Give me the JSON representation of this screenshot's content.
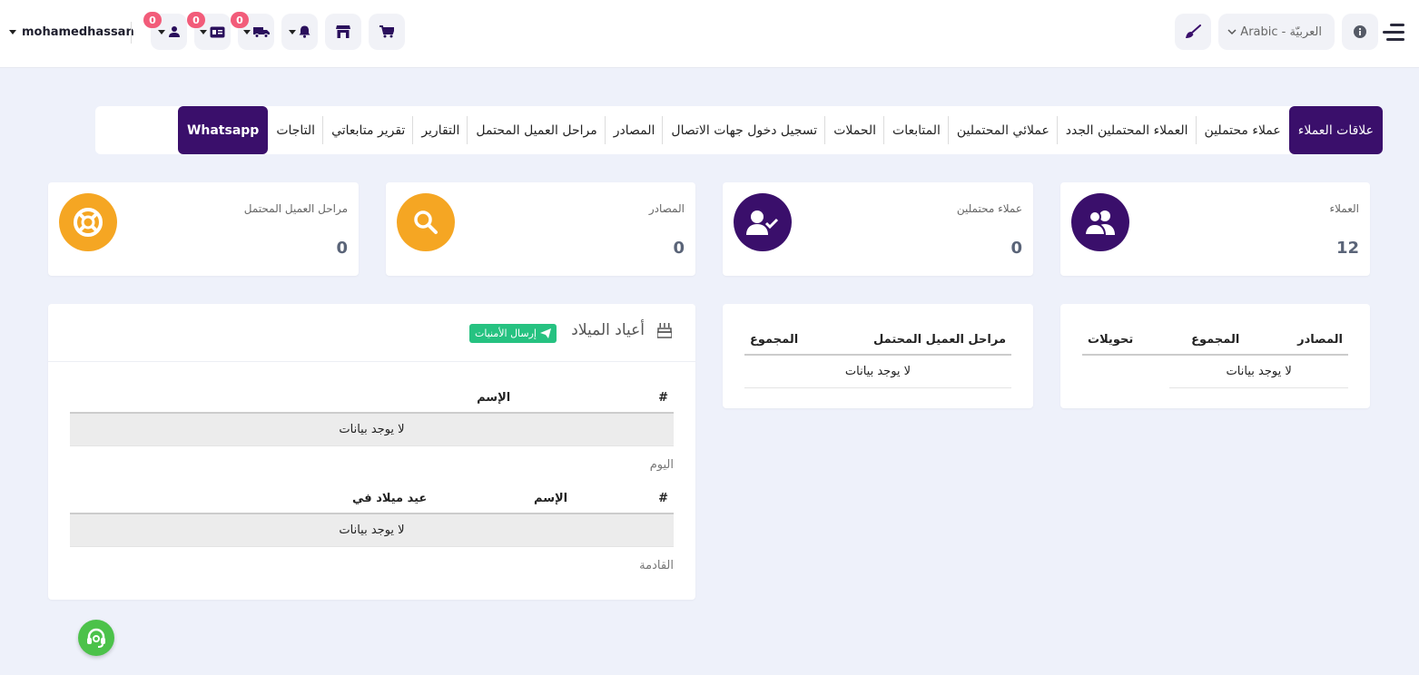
{
  "header": {
    "username": "mohamedhassan",
    "badges": {
      "users": "0",
      "cards": "0",
      "shipping": "0"
    },
    "language": "Arabic - العربيّة"
  },
  "nav": {
    "tabs": [
      "علاقات العملاء",
      "عملاء محتملين",
      "العملاء المحتملين الجدد",
      "عملائي المحتملين",
      "المتابعات",
      "الحملات",
      "تسجيل دخول جهات الاتصال",
      "المصادر",
      "مراحل العميل المحتمل",
      "التقارير",
      "تقرير متابعاتي",
      "التاجات",
      "Whatsapp"
    ]
  },
  "stats": [
    {
      "label": "العملاء",
      "value": "12",
      "icon": "users-icon",
      "color": "#3a0f6b"
    },
    {
      "label": "عملاء محتملين",
      "value": "0",
      "icon": "user-check-icon",
      "color": "#3a0f6b"
    },
    {
      "label": "المصادر",
      "value": "0",
      "icon": "search-icon",
      "color": "#f5a623"
    },
    {
      "label": "مراحل العميل المحتمل",
      "value": "0",
      "icon": "lifebuoy-icon",
      "color": "#f5a623"
    }
  ],
  "sources_table": {
    "headers": [
      "المصادر",
      "المجموع",
      "تحويلات"
    ],
    "empty": "لا يوجد بيانات"
  },
  "stages_table": {
    "headers": [
      "مراحل العميل المحتمل",
      "المجموع"
    ],
    "empty": "لا يوجد بيانات"
  },
  "birthdays": {
    "title": "أعياد الميلاد",
    "send_label": "إرسال الأمنيات",
    "today": {
      "headers": [
        "#",
        "الإسم"
      ],
      "empty": "لا يوجد بيانات",
      "caption": "اليوم"
    },
    "upcoming": {
      "headers": [
        "#",
        "الإسم",
        "عيد ميلاد في"
      ],
      "empty": "لا يوجد بيانات",
      "caption": "القادمة"
    }
  }
}
